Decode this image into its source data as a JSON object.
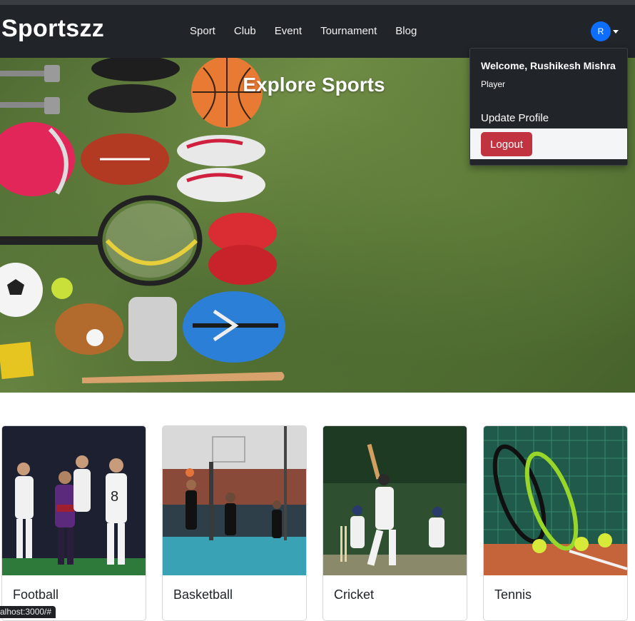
{
  "brand": "Sportszz",
  "nav": [
    "Sport",
    "Club",
    "Event",
    "Tournament",
    "Blog"
  ],
  "user": {
    "initial": "R",
    "welcome": "Welcome, Rushikesh Mishra",
    "role": "Player",
    "update_profile": "Update Profile",
    "logout": "Logout"
  },
  "hero": {
    "title": "Explore Sports"
  },
  "cards": [
    "Football",
    "Basketball",
    "Cricket",
    "Tennis"
  ],
  "status_url": "alhost:3000/#",
  "colors": {
    "navbar": "#212529",
    "avatar": "#0d6efd",
    "logout": "#c13340",
    "grass": "#5f7c3b"
  }
}
